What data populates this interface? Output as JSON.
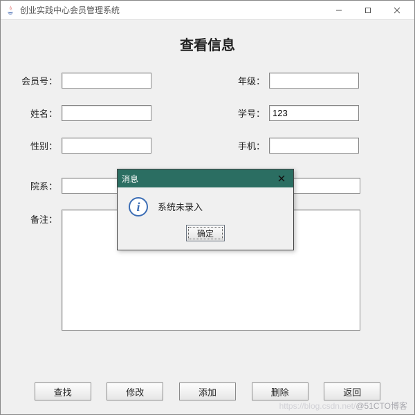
{
  "window": {
    "title": "创业实践中心会员管理系统"
  },
  "heading": "查看信息",
  "labels": {
    "member_id": "会员号：",
    "name": "姓名：",
    "gender": "性别：",
    "department": "院系：",
    "remark": "备注：",
    "grade": "年级：",
    "student_id": "学号：",
    "phone": "手机："
  },
  "values": {
    "member_id": "",
    "name": "",
    "gender": "",
    "department": "",
    "remark": "",
    "grade": "",
    "student_id": "123",
    "phone": ""
  },
  "buttons": {
    "search": "查找",
    "modify": "修改",
    "add": "添加",
    "delete": "删除",
    "back": "返回"
  },
  "modal": {
    "title": "消息",
    "message": "系统未录入",
    "ok": "确定"
  },
  "watermark": {
    "faint": "https://blog.csdn.net/",
    "handle": "@51CTO博客"
  },
  "icons": {
    "info_glyph": "i"
  }
}
